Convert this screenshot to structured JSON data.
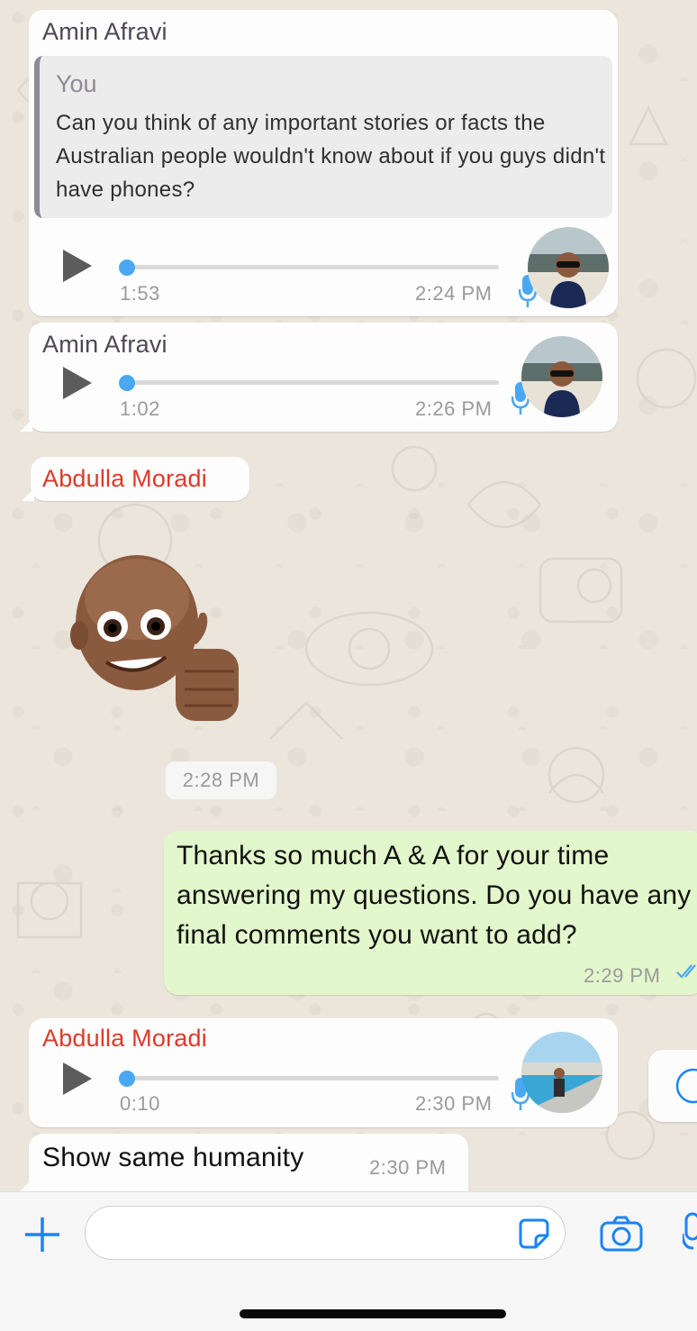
{
  "messages": [
    {
      "sender": "Amin Afravi",
      "quote_author": "You",
      "quote_text": "Can you think of any important stories or facts the Australian people wouldn't know about if you guys didn't have phones?",
      "voice_duration": "1:53",
      "time": "2:24 PM"
    },
    {
      "sender": "Amin Afravi",
      "voice_duration": "1:02",
      "time": "2:26 PM"
    },
    {
      "sender": "Abdulla Moradi",
      "sticker": "memoji-thumbs-up",
      "time": "2:28 PM"
    },
    {
      "text": "Thanks so much A & A for your time answering my questions. Do you have any final comments you want to add?",
      "time": "2:29 PM",
      "status": "read"
    },
    {
      "sender": "Abdulla Moradi",
      "voice_duration": "0:10",
      "time": "2:30 PM"
    },
    {
      "text": "Show same humanity",
      "time": "2:30 PM"
    }
  ],
  "composer": {
    "placeholder": "",
    "icons": [
      "plus-icon",
      "sticker-icon",
      "camera-icon",
      "mic-icon"
    ]
  },
  "colors": {
    "accent": "#1a84f5",
    "incoming_bubble": "#fdfdfd",
    "outgoing_bubble": "#e2f7cb",
    "sender_red": "#dc3a2a",
    "voice_progress": "#4aa8f2"
  }
}
